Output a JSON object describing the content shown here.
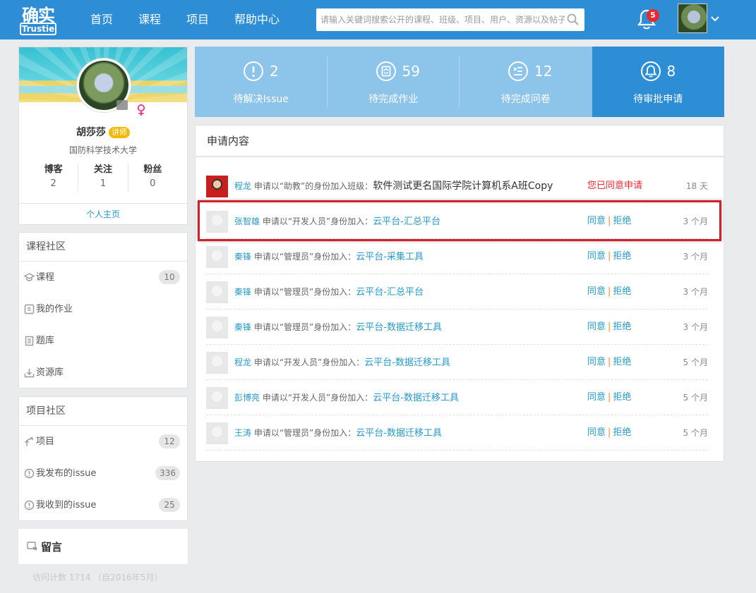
{
  "header": {
    "logo_top": "确实",
    "logo_bottom": "Trustie",
    "nav": [
      "首页",
      "课程",
      "项目",
      "帮助中心"
    ],
    "search_placeholder": "请输入关键词搜索公开的课程、班级、项目、用户、资源以及帖子",
    "notification_count": "5"
  },
  "profile": {
    "name": "胡莎莎",
    "role_tag": "讲师",
    "school": "国防科学技术大学",
    "stats": [
      {
        "label": "博客",
        "value": "2"
      },
      {
        "label": "关注",
        "value": "1"
      },
      {
        "label": "粉丝",
        "value": "0"
      }
    ],
    "homepage_link": "个人主页"
  },
  "course_community": {
    "title": "课程社区",
    "items": [
      {
        "label": "课程",
        "icon": "graduation-cap-icon",
        "count": "10"
      },
      {
        "label": "我的作业",
        "icon": "homework-icon",
        "count": ""
      },
      {
        "label": "题库",
        "icon": "document-icon",
        "count": ""
      },
      {
        "label": "资源库",
        "icon": "download-tray-icon",
        "count": ""
      }
    ]
  },
  "project_community": {
    "title": "项目社区",
    "items": [
      {
        "label": "项目",
        "icon": "fork-icon",
        "count": "12"
      },
      {
        "label": "我发布的issue",
        "icon": "alert-circle-icon",
        "count": "336"
      },
      {
        "label": "我收到的issue",
        "icon": "alert-circle-icon",
        "count": "25"
      }
    ]
  },
  "message_board": {
    "title": "留言"
  },
  "visits": "访问计数 1714 （自2016年5月）",
  "top_stats": [
    {
      "num": "2",
      "label": "待解决Issue",
      "icon": "alert-circle-icon"
    },
    {
      "num": "59",
      "label": "待完成作业",
      "icon": "homework-icon"
    },
    {
      "num": "12",
      "label": "待完成问卷",
      "icon": "list-icon"
    },
    {
      "num": "8",
      "label": "待审批申请",
      "icon": "bell-icon"
    }
  ],
  "panel": {
    "title": "申请内容",
    "rows": [
      {
        "user": "程龙",
        "text": "申请以“助教”的身份加入班级：",
        "target": "软件测试更名国际学院计算机系A班Copy",
        "status": "您已同意申请",
        "time": "18 天"
      },
      {
        "user": "张智雄",
        "text": "申请以“开发人员”身份加入：",
        "target": "云平台-汇总平台",
        "agree": "同意",
        "reject": "拒绝",
        "time": "3 个月"
      },
      {
        "user": "秦锋",
        "text": "申请以“管理员”身份加入：",
        "target": "云平台-采集工具",
        "agree": "同意",
        "reject": "拒绝",
        "time": "3 个月"
      },
      {
        "user": "秦锋",
        "text": "申请以“管理员”身份加入：",
        "target": "云平台-汇总平台",
        "agree": "同意",
        "reject": "拒绝",
        "time": "3 个月"
      },
      {
        "user": "秦锋",
        "text": "申请以“管理员”身份加入：",
        "target": "云平台-数据迁移工具",
        "agree": "同意",
        "reject": "拒绝",
        "time": "3 个月"
      },
      {
        "user": "程龙",
        "text": "申请以“开发人员”身份加入：",
        "target": "云平台-数据迁移工具",
        "agree": "同意",
        "reject": "拒绝",
        "time": "5 个月"
      },
      {
        "user": "彭博亮",
        "text": "申请以“开发人员”身份加入：",
        "target": "云平台-数据迁移工具",
        "agree": "同意",
        "reject": "拒绝",
        "time": "5 个月"
      },
      {
        "user": "王涛",
        "text": "申请以“管理员”身份加入：",
        "target": "云平台-数据迁移工具",
        "agree": "同意",
        "reject": "拒绝",
        "time": "5 个月"
      }
    ]
  },
  "colors": {
    "header": "#2e8ed5",
    "stat_tile": "#8dc4ea",
    "link": "#269ac9",
    "highlight": "#d0212a"
  }
}
